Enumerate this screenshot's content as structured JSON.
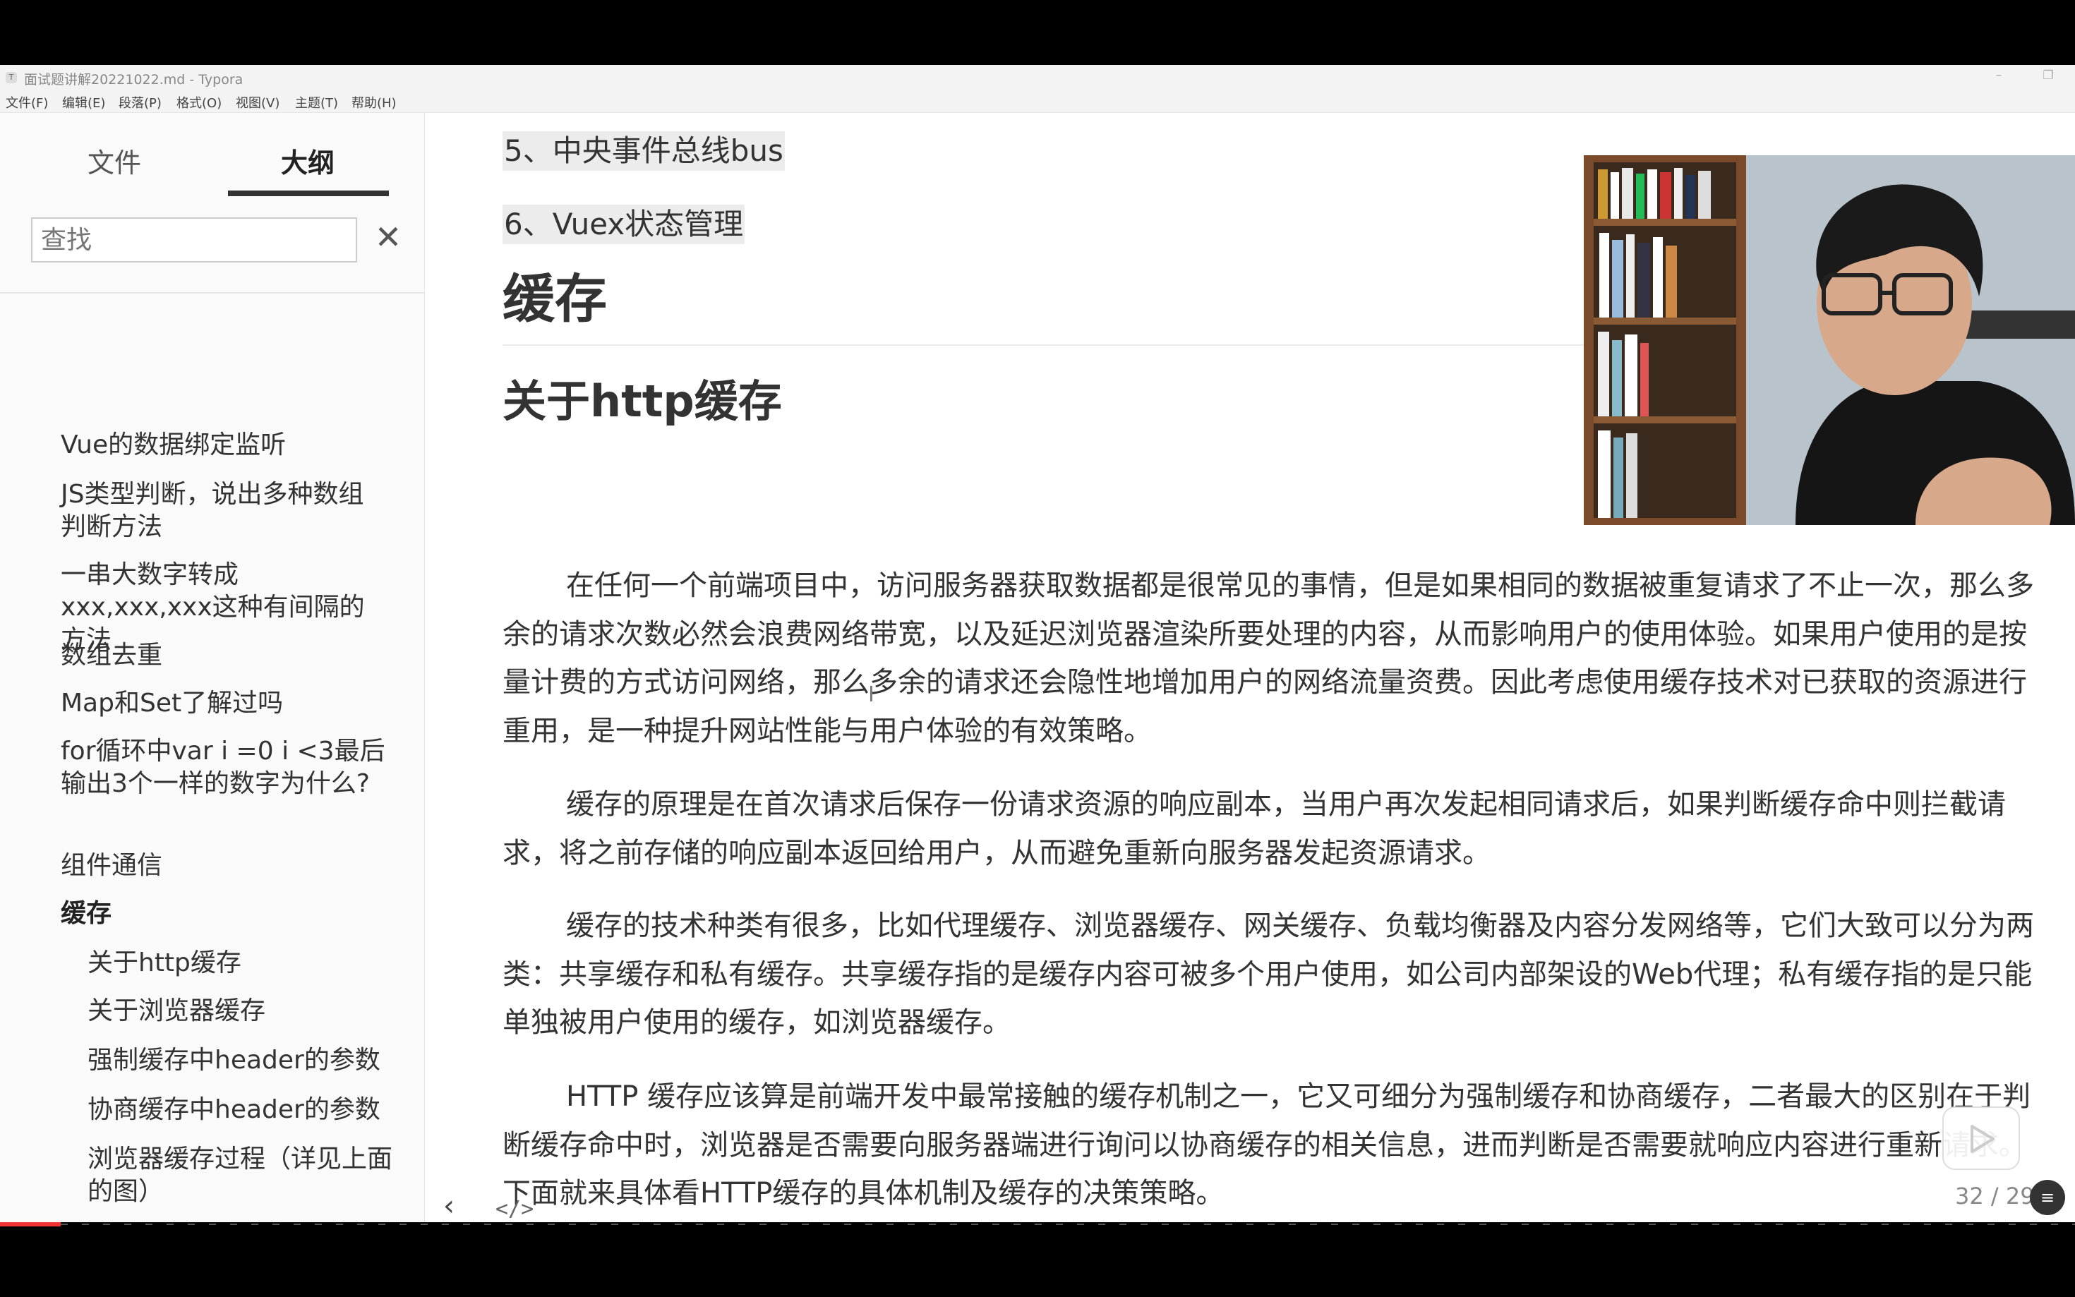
{
  "window": {
    "title": "面试题讲解20221022.md - Typora"
  },
  "menu": {
    "items": [
      "文件(F)",
      "编辑(E)",
      "段落(P)",
      "格式(O)",
      "视图(V)",
      "主题(T)",
      "帮助(H)"
    ]
  },
  "sidebar": {
    "tabs": [
      "文件",
      "大纲"
    ],
    "active_tab": "大纲",
    "search_placeholder": "查找",
    "clear_icon": "close-icon",
    "outline": [
      {
        "label": "Vue的数据绑定监听",
        "level": 1
      },
      {
        "label": "JS类型判断，说出多种数组判断方法",
        "level": 1
      },
      {
        "label": "一串大数字转成 xxx,xxx,xxx这种有间隔的方法",
        "level": 1
      },
      {
        "label": "数组去重",
        "level": 1
      },
      {
        "label": "Map和Set了解过吗",
        "level": 1
      },
      {
        "label": "for循环中var i =0 i <3最后输出3个一样的数字为什么?",
        "level": 1
      },
      {
        "label": "组件通信",
        "level": 1
      },
      {
        "label": "缓存",
        "level": 1,
        "active": true
      },
      {
        "label": "关于http缓存",
        "level": 2
      },
      {
        "label": "关于浏览器缓存",
        "level": 2
      },
      {
        "label": "强制缓存中header的参数",
        "level": 2
      },
      {
        "label": "协商缓存中header的参数",
        "level": 2
      },
      {
        "label": "浏览器缓存过程（详见上面的图）",
        "level": 2
      }
    ]
  },
  "document": {
    "list_items": [
      "5、中央事件总线bus",
      "6、Vuex状态管理"
    ],
    "h1": "缓存",
    "h2": "关于http缓存",
    "paragraphs": [
      "在任何一个前端项目中，访问服务器获取数据都是很常见的事情，但是如果相同的数据被重复请求了不止一次，那么多余的请求次数必然会浪费网络带宽，以及延迟浏览器渲染所要处理的内容，从而影响用户的使用体验。如果用户使用的是按量计费的方式访问网络，那么多余的请求还会隐性地增加用户的网络流量资费。因此考虑使用缓存技术对已获取的资源进行重用，是一种提升网站性能与用户体验的有效策略。",
      "缓存的原理是在首次请求后保存一份请求资源的响应副本，当用户再次发起相同请求后，如果判断缓存命中则拦截请求，将之前存储的响应副本返回给用户，从而避免重新向服务器发起资源请求。",
      "缓存的技术种类有很多，比如代理缓存、浏览器缓存、网关缓存、负载均衡器及内容分发网络等，它们大致可以分为两类：共享缓存和私有缓存。共享缓存指的是缓存内容可被多个用户使用，如公司内部架设的Web代理；私有缓存指的是只能单独被用户使用的缓存，如浏览器缓存。",
      "HTTP 缓存应该算是前端开发中最常接触的缓存机制之一，它又可细分为强制缓存和协商缓存，二者最大的区别在于判断缓存命中时，浏览器是否需要向服务器端进行询问以协商缓存的相关信息，进而判断是否需要就响应内容进行重新请求。下面就来具体看HTTP缓存的具体机制及缓存的决策策略。"
    ]
  },
  "footer": {
    "word_count": "32 / 29"
  },
  "colors": {
    "highlight": "#ececec",
    "progress": "#e33"
  }
}
